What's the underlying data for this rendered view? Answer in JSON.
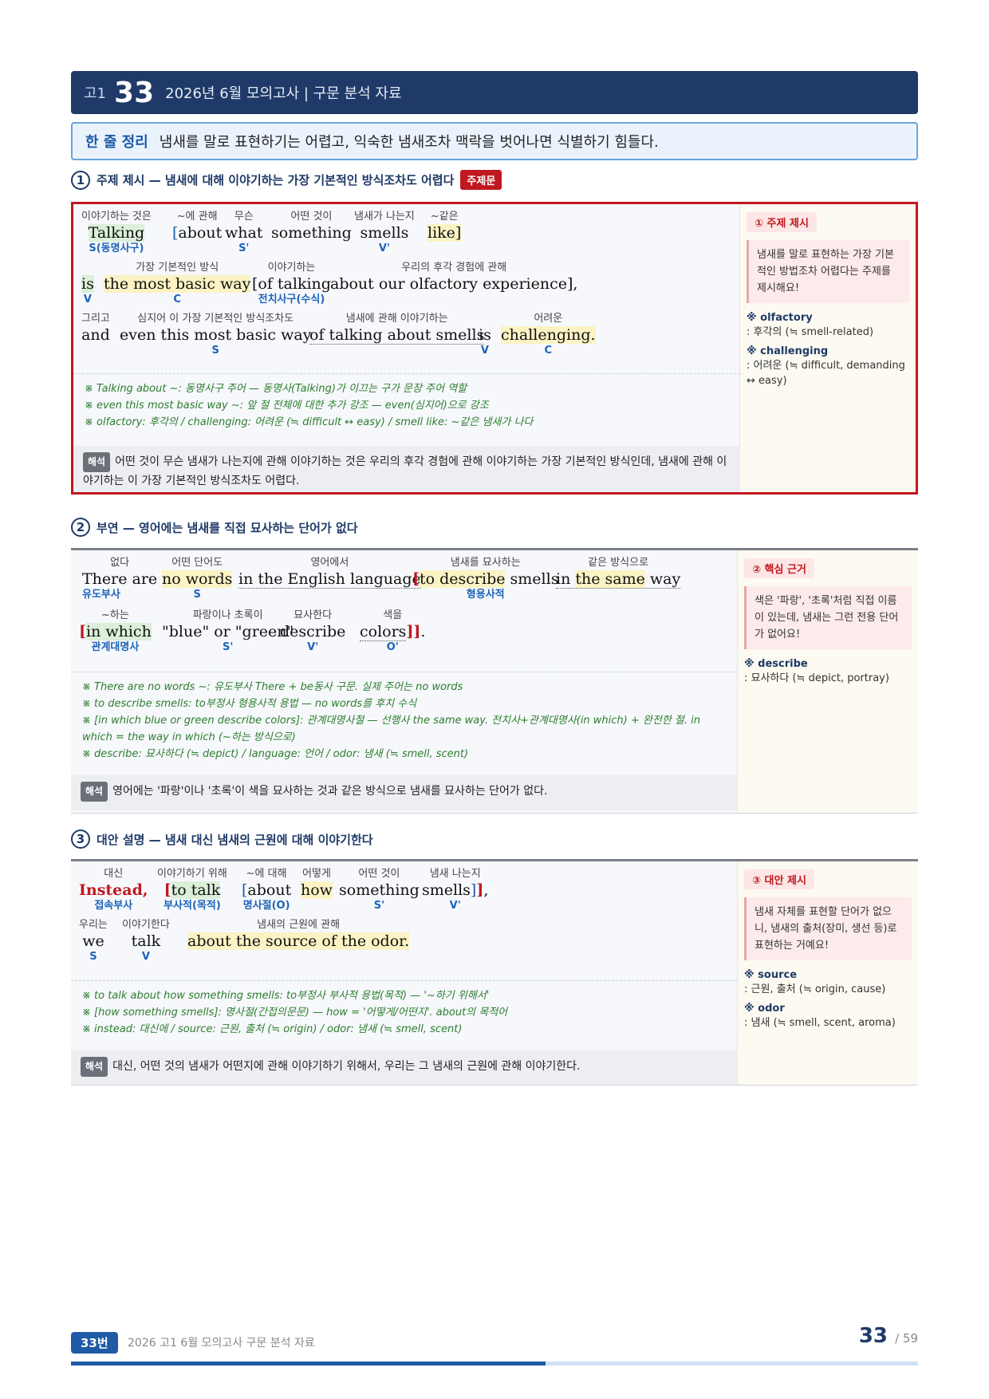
{
  "header": {
    "grade": "고1",
    "num": "33",
    "title": "2026년 6월 모의고사 | 구문 분석 자료"
  },
  "summary": {
    "label": "한 줄 정리",
    "text": "냄새를 말로 표현하기는 어렵고, 익숙한 냄새조차 맥락을 벗어나면 식별하기 힘들다."
  },
  "s1": {
    "n": "1",
    "title": "주제 제시 — 냄새에 대해 이야기하는 가장 기본적인 방식조차도 어렵다",
    "tag": "주제문",
    "l1": [
      {
        "g": "이야기하는 것은",
        "w": "Talking",
        "r": "S(동명사구)"
      },
      {
        "g": "~에 관해",
        "w": "[about",
        "r": ""
      },
      {
        "g": "무슨",
        "w": "what",
        "r": "S'"
      },
      {
        "g": "어떤 것이",
        "w": "something",
        "r": ""
      },
      {
        "g": "냄새가 나는지",
        "w": "smells",
        "r": "V'"
      },
      {
        "g": "~같은",
        "w": "like]",
        "r": ""
      }
    ],
    "l2": [
      {
        "g": "",
        "w": "is",
        "r": "V"
      },
      {
        "g": "가장 기본적인 방식",
        "w": "the most basic way",
        "r": "C"
      },
      {
        "g": "이야기하는",
        "w": "[of talking",
        "r": "전치사구(수식)"
      },
      {
        "g": "우리의 후각 경험에 관해",
        "w": "about our olfactory experience],",
        "r": ""
      }
    ],
    "l3": [
      {
        "g": "그리고",
        "w": "and",
        "r": ""
      },
      {
        "g": "심지어 이 가장 기본적인 방식조차도",
        "w": "even this most basic way",
        "r": "S"
      },
      {
        "g": "냄새에 관해 이야기하는",
        "w": "of talking about smells",
        "r": ""
      },
      {
        "g": "",
        "w": "is",
        "r": "V"
      },
      {
        "g": "어려운",
        "w": "challenging.",
        "r": "C"
      }
    ],
    "notes": [
      "※ Talking about ~: 동명사구 주어 — 동명사(Talking)가 이끄는 구가 문장 주어 역할",
      "※ even this most basic way ~: 앞 절 전체에 대한 추가 강조 — even(심지어)으로 강조",
      "※ olfactory: 후각의 / challenging: 어려운 (≒ difficult ↔ easy) / smell like: ~같은 냄새가 나다"
    ],
    "trans_tag": "해석",
    "trans": "어떤 것이 무슨 냄새가 나는지에 관해 이야기하는 것은 우리의 후각 경험에 관해 이야기하는 가장 기본적인 방식인데, 냄새에 관해 이야기하는 이 가장 기본적인 방식조차도 어렵다.",
    "side_tag": "① 주제 제시",
    "side_point": "냄새를 말로 표현하는 가장 기본적인 방법조차 어렵다는 주제를 제시해요!",
    "vocab": [
      {
        "w": "※ olfactory",
        "d": ": 후각의 (≒ smell-related)"
      },
      {
        "w": "※ challenging",
        "d": ": 어려운 (≒ difficult, demanding ↔ easy)"
      }
    ]
  },
  "s2": {
    "n": "2",
    "title": "부연 — 영어에는 냄새를 직접 묘사하는 단어가 없다",
    "l1": [
      {
        "g": "없다",
        "w": "There are",
        "r": "유도부사"
      },
      {
        "g": "어떤 단어도",
        "w": "no words",
        "r": "S"
      },
      {
        "g": "영어에서",
        "w": "in the English language",
        "r": ""
      },
      {
        "g": "냄새를 묘사하는",
        "w": "[to describe smells",
        "r": "형용사적"
      },
      {
        "g": "같은 방식으로",
        "w": "in the same way",
        "r": ""
      }
    ],
    "l2": [
      {
        "g": "~하는",
        "w": "[in which",
        "r": "관계대명사"
      },
      {
        "g": "파랑이나 초록이",
        "w": "\"blue\" or \"green\"",
        "r": "S'"
      },
      {
        "g": "묘사한다",
        "w": "describe",
        "r": "V'"
      },
      {
        "g": "색을",
        "w": "colors]].",
        "r": "O'"
      }
    ],
    "notes": [
      "※ There are no words ~: 유도부사 There + be동사 구문. 실제 주어는 no words",
      "※ to describe smells: to부정사 형용사적 용법 — no words를 후치 수식",
      "※ [in which blue or green describe colors]: 관계대명사절 — 선행사 the same way. 전치사+관계대명사(in which) + 완전한 절. in which = the way in which (~하는 방식으로)",
      "※ describe: 묘사하다 (≒ depict) / language: 언어 / odor: 냄새 (≒ smell, scent)"
    ],
    "trans_tag": "해석",
    "trans": "영어에는 '파랑'이나 '초록'이 색을 묘사하는 것과 같은 방식으로 냄새를 묘사하는 단어가 없다.",
    "side_tag": "② 핵심 근거",
    "side_point": "색은 '파랑', '초록'처럼 직접 이름이 있는데, 냄새는 그런 전용 단어가 없어요!",
    "vocab": [
      {
        "w": "※ describe",
        "d": ": 묘사하다 (≒ depict, portray)"
      }
    ]
  },
  "s3": {
    "n": "3",
    "title": "대안 설명 — 냄새 대신 냄새의 근원에 대해 이야기한다",
    "l1": [
      {
        "g": "대신",
        "w": "Instead,",
        "r": "접속부사"
      },
      {
        "g": "이야기하기 위해",
        "w": "[to talk",
        "r": "부사적(목적)"
      },
      {
        "g": "~에 대해",
        "w": "[about",
        "r": "명사절(O)"
      },
      {
        "g": "어떻게",
        "w": "how",
        "r": ""
      },
      {
        "g": "어떤 것이",
        "w": "something",
        "r": "S'"
      },
      {
        "g": "냄새 나는지",
        "w": "smells]],",
        "r": "V'"
      }
    ],
    "l2": [
      {
        "g": "우리는",
        "w": "we",
        "r": "S"
      },
      {
        "g": "이야기한다",
        "w": "talk",
        "r": "V"
      },
      {
        "g": "냄새의 근원에 관해",
        "w": "about the source of the odor.",
        "r": ""
      }
    ],
    "notes": [
      "※ to talk about how something smells: to부정사 부사적 용법(목적) — '~하기 위해서'",
      "※ [how something smells]: 명사절(간접의문문) — how = '어떻게/어떤지'. about의 목적어",
      "※ instead: 대신에 / source: 근원, 출처 (≒ origin) / odor: 냄새 (≒ smell, scent)"
    ],
    "trans_tag": "해석",
    "trans": "대신, 어떤 것의 냄새가 어떤지에 관해 이야기하기 위해서, 우리는 그 냄새의 근원에 관해 이야기한다.",
    "side_tag": "③ 대안 제시",
    "side_point": "냄새 자체를 표현할 단어가 없으니, 냄새의 출처(장미, 생선 등)로 표현하는 거예요!",
    "vocab": [
      {
        "w": "※ source",
        "d": ": 근원, 출처 (≒ origin, cause)"
      },
      {
        "w": "※ odor",
        "d": ": 냄새 (≒ smell, scent, aroma)"
      }
    ]
  },
  "footer": {
    "badge": "33번",
    "text": "2026 고1 6월 모의고사 구문 분석 자료",
    "page": "33",
    "total": "/ 59",
    "progress": 0.56
  }
}
